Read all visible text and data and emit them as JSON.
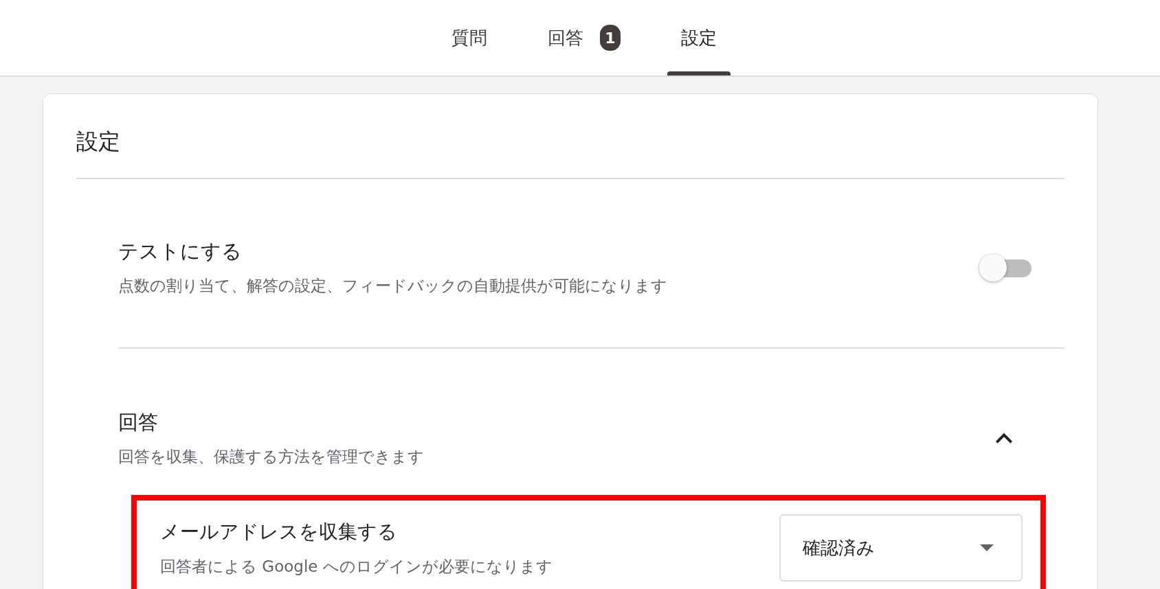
{
  "tabs": [
    {
      "label": "質問",
      "selected": false
    },
    {
      "label": "回答",
      "selected": false,
      "badge": "1"
    },
    {
      "label": "設定",
      "selected": true
    }
  ],
  "settings": {
    "title": "設定",
    "quiz": {
      "title": "テストにする",
      "description": "点数の割り当て、解答の設定、フィードバックの自動提供が可能になります",
      "on": false
    },
    "responses": {
      "title": "回答",
      "description": "回答を収集、保護する方法を管理できます",
      "expanded": true,
      "email": {
        "title": "メールアドレスを収集する",
        "description": "回答者による Google へのログインが必要になります",
        "value": "確認済み",
        "highlighted": true
      }
    }
  }
}
